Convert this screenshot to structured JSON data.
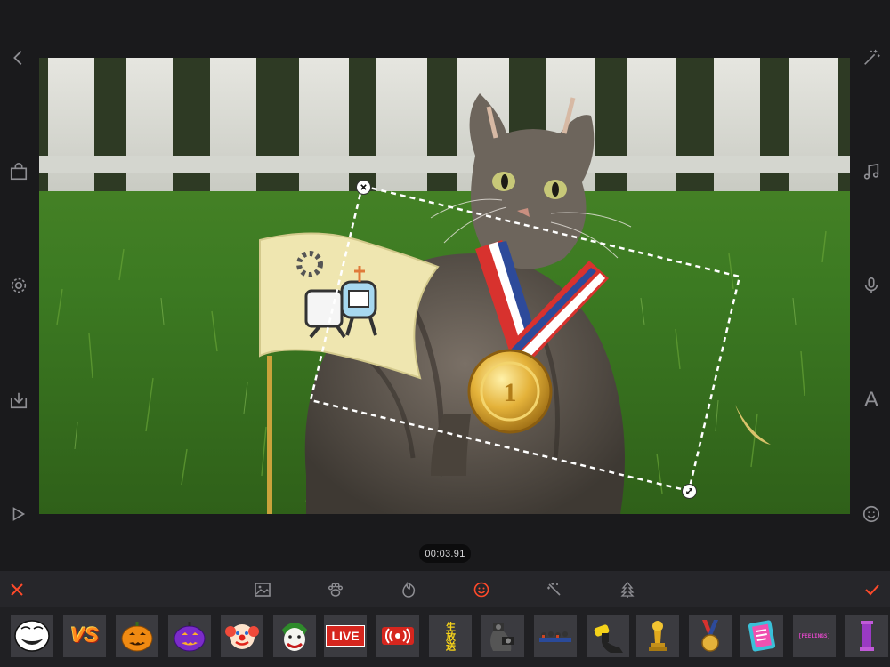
{
  "left_rail": {
    "back": "chevron-left-icon",
    "store": "shopping-bag-icon",
    "settings": "gear-icon",
    "export": "download-tray-icon",
    "play": "play-icon"
  },
  "right_rail": {
    "magic": "magic-wand-icon",
    "music": "music-note-icon",
    "voice": "microphone-icon",
    "text": "text-icon",
    "sticker": "smiley-icon",
    "text_glyph": "A"
  },
  "playhead": {
    "time": "00:03.91"
  },
  "toolbar": {
    "cancel": "close-icon",
    "confirm": "checkmark-icon",
    "tabs": [
      {
        "name": "image-icon",
        "active": false
      },
      {
        "name": "paw-icon",
        "active": false
      },
      {
        "name": "flame-icon",
        "active": false
      },
      {
        "name": "emoji-icon",
        "active": true
      },
      {
        "name": "sparkle-wand-icon",
        "active": false
      },
      {
        "name": "tree-icon",
        "active": false
      }
    ]
  },
  "stickers": {
    "vs_text": "VS",
    "live_text": "LIVE",
    "chinese_text": "生放送",
    "banner_text": "[FEELINGS]",
    "items": [
      "troll-face",
      "vs",
      "pumpkin-orange",
      "pumpkin-purple",
      "clown",
      "joker",
      "live",
      "broadcast",
      "chinese-label",
      "photographer",
      "riders",
      "microphone-hand",
      "trophy",
      "medal",
      "list-card",
      "feelings-banner",
      "pillar"
    ]
  },
  "colors": {
    "accent": "#ff4a2a",
    "icon": "#8e8e93",
    "background": "#1a1a1c",
    "toolbar": "#26262a",
    "tile": "#3b3b40"
  }
}
